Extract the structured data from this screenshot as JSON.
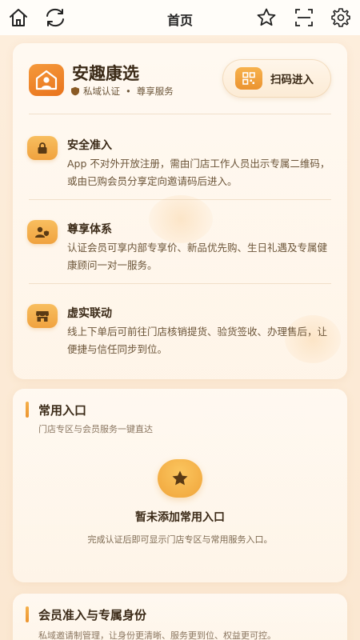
{
  "topbar": {
    "title": "首页",
    "icons": [
      "home-icon",
      "refresh-icon",
      "star-icon",
      "scan-icon",
      "gear-icon"
    ]
  },
  "brand": {
    "name": "安趣康选",
    "tag1": "私域认证",
    "separator": "•",
    "tag2": "尊享服务",
    "scan_label": "扫码进入"
  },
  "features": [
    {
      "icon": "lock-icon",
      "title": "安全准入",
      "desc": "App 不对外开放注册，需由门店工作人员出示专属二维码，或由已购会员分享定向邀请码后进入。"
    },
    {
      "icon": "member-shield-icon",
      "title": "尊享体系",
      "desc": "认证会员可享内部专享价、新品优先购、生日礼遇及专属健康顾问一对一服务。"
    },
    {
      "icon": "store-icon",
      "title": "虚实联动",
      "desc": "线上下单后可前往门店核销提货、验货签收、办理售后，让便捷与信任同步到位。"
    }
  ],
  "shortcuts": {
    "title": "常用入口",
    "subtitle": "门店专区与会员服务一键直达",
    "empty_title": "暂未添加常用入口",
    "empty_desc": "完成认证后即可显示门店专区与常用服务入口。"
  },
  "membership": {
    "title": "会员准入与专属身份",
    "subtitle": "私域邀请制管理，让身份更清晰、服务更到位、权益更可控。"
  },
  "colors": {
    "accent": "#F0A23E",
    "brand": "#E9731C",
    "background": "#FCEBD7",
    "text": "#3B2A17"
  }
}
